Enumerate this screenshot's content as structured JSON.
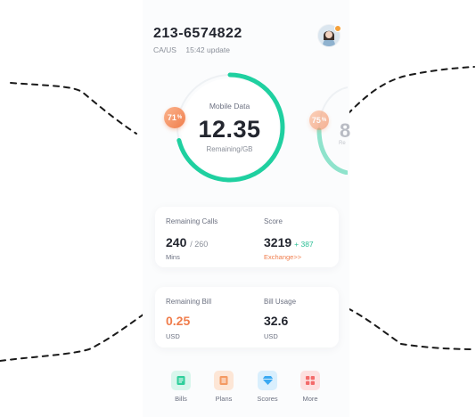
{
  "account": {
    "phone_number": "213-6574822",
    "region": "CA/US",
    "update_time": "15:42 update"
  },
  "mobile_data": {
    "title": "Mobile Data",
    "remaining": "12.35",
    "remaining_label": "Remaining/GB",
    "percent": "71",
    "percent_unit": "%",
    "fill_fraction": 0.71
  },
  "next_card": {
    "percent": "75",
    "percent_unit": "%",
    "value_partial": "8",
    "label_partial": "Re"
  },
  "stats": {
    "calls": {
      "label": "Remaining Calls",
      "value": "240",
      "total": "/ 260",
      "unit": "Mins"
    },
    "score": {
      "label": "Score",
      "value": "3219",
      "delta": "+ 387",
      "link": "Exchange>>"
    },
    "bill": {
      "label": "Remaining Bill",
      "value": "0.25",
      "unit": "USD"
    },
    "usage": {
      "label": "Bill Usage",
      "value": "32.6",
      "unit": "USD"
    }
  },
  "nav": [
    {
      "label": "Bills",
      "icon": "bills-icon",
      "color": "#2fcf9b"
    },
    {
      "label": "Plans",
      "icon": "plans-icon",
      "color": "#f49a62"
    },
    {
      "label": "Scores",
      "icon": "scores-icon",
      "color": "#3aa9f2"
    },
    {
      "label": "More",
      "icon": "more-icon",
      "color": "#f36b6b"
    }
  ],
  "colors": {
    "accent": "#1fd0a0",
    "orange": "#f07d4c",
    "text": "#23262f"
  }
}
